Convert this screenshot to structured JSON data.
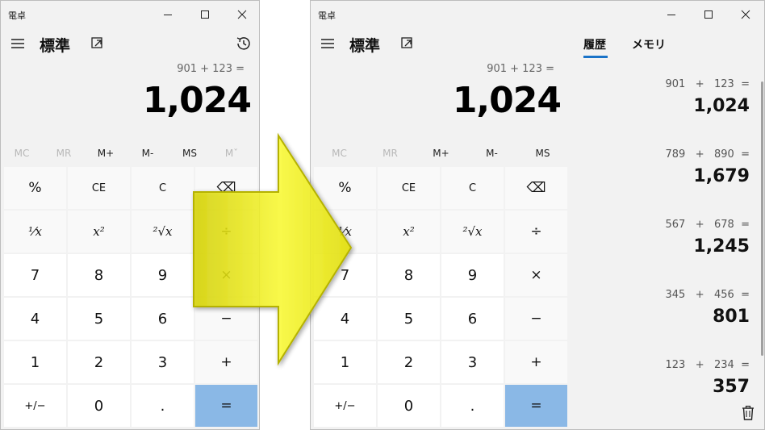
{
  "left": {
    "title": "電卓",
    "mode": "標準",
    "expression": "901 + 123 =",
    "result": "1,024",
    "memory": [
      "MC",
      "MR",
      "M+",
      "M-",
      "MS",
      "Mˇ"
    ],
    "memory_disabled": [
      true,
      true,
      false,
      false,
      false,
      true
    ],
    "keys": [
      {
        "label": "%",
        "type": "op"
      },
      {
        "label": "CE",
        "type": "op"
      },
      {
        "label": "C",
        "type": "op"
      },
      {
        "label": "⌫",
        "type": "op"
      },
      {
        "label": "¹⁄x",
        "type": "op"
      },
      {
        "label": "x²",
        "type": "op"
      },
      {
        "label": "²√x",
        "type": "op"
      },
      {
        "label": "÷",
        "type": "op"
      },
      {
        "label": "7",
        "type": "num"
      },
      {
        "label": "8",
        "type": "num"
      },
      {
        "label": "9",
        "type": "num"
      },
      {
        "label": "×",
        "type": "op"
      },
      {
        "label": "4",
        "type": "num"
      },
      {
        "label": "5",
        "type": "num"
      },
      {
        "label": "6",
        "type": "num"
      },
      {
        "label": "−",
        "type": "op"
      },
      {
        "label": "1",
        "type": "num"
      },
      {
        "label": "2",
        "type": "num"
      },
      {
        "label": "3",
        "type": "num"
      },
      {
        "label": "+",
        "type": "op"
      },
      {
        "label": "+/−",
        "type": "num"
      },
      {
        "label": "0",
        "type": "num"
      },
      {
        "label": ".",
        "type": "num"
      },
      {
        "label": "=",
        "type": "eq"
      }
    ]
  },
  "right": {
    "title": "電卓",
    "mode": "標準",
    "expression": "901 + 123 =",
    "result": "1,024",
    "memory": [
      "MC",
      "MR",
      "M+",
      "M-",
      "MS"
    ],
    "memory_disabled": [
      true,
      true,
      false,
      false,
      false
    ],
    "tabs": [
      "履歴",
      "メモリ"
    ],
    "active_tab": "履歴",
    "history": [
      {
        "expr": "901   +   123  =",
        "result": "1,024"
      },
      {
        "expr": "789   +   890  =",
        "result": "1,679"
      },
      {
        "expr": "567   +   678  =",
        "result": "1,245"
      },
      {
        "expr": "345   +   456  =",
        "result": "801"
      },
      {
        "expr": "123   +   234  =",
        "result": "357"
      }
    ]
  },
  "colors": {
    "window_bg": "#f2f2f2",
    "equals_key": "#8ab8e6",
    "accent": "#1a73c8",
    "arrow_fill": "#f4f21a"
  },
  "icons": [
    "hamburger-icon",
    "keep-on-top-icon",
    "history-icon",
    "minimize-icon",
    "maximize-icon",
    "close-icon",
    "trash-icon",
    "arrow-right-icon"
  ]
}
